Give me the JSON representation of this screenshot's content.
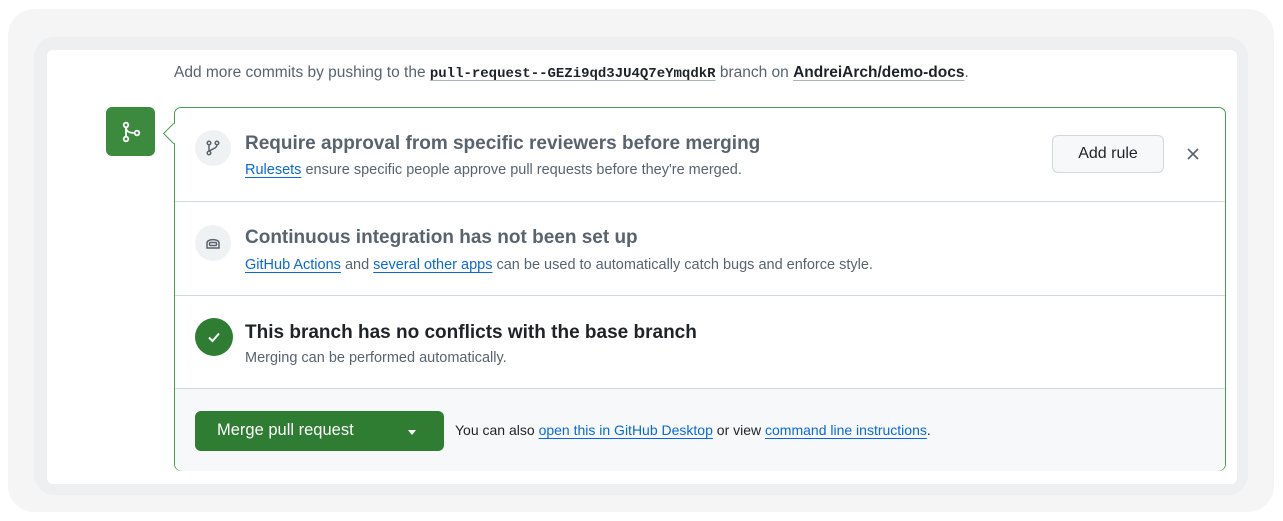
{
  "intro": {
    "prefix": "Add more commits by pushing to the ",
    "branch": "pull-request--GEZi9qd3JU4Q7eYmqdkR",
    "middle": " branch on ",
    "repo": "AndreiArch/demo-docs",
    "suffix": "."
  },
  "rule_section": {
    "title": "Require approval from specific reviewers before merging",
    "link": "Rulesets",
    "text": " ensure specific people approve pull requests before they're merged.",
    "add_rule_label": "Add rule",
    "close_label": "×"
  },
  "ci_section": {
    "title": "Continuous integration has not been set up",
    "link1": "GitHub Actions",
    "and": " and ",
    "link2": "several other apps",
    "text": " can be used to automatically catch bugs and enforce style."
  },
  "conflict_section": {
    "title": "This branch has no conflicts with the base branch",
    "text": "Merging can be performed automatically."
  },
  "merge_section": {
    "button_label": "Merge pull request",
    "note_prefix": "You can also ",
    "link1": "open this in GitHub Desktop",
    "middle": " or view ",
    "link2": "command line instructions",
    "suffix": "."
  },
  "colors": {
    "success_green": "#2e7d32",
    "border_green": "#4a9e52",
    "link_blue": "#0969da"
  },
  "icons": [
    "git-merge-icon",
    "git-branch-icon",
    "ci-robot-icon",
    "check-icon",
    "close-icon",
    "triangle-down-icon"
  ]
}
